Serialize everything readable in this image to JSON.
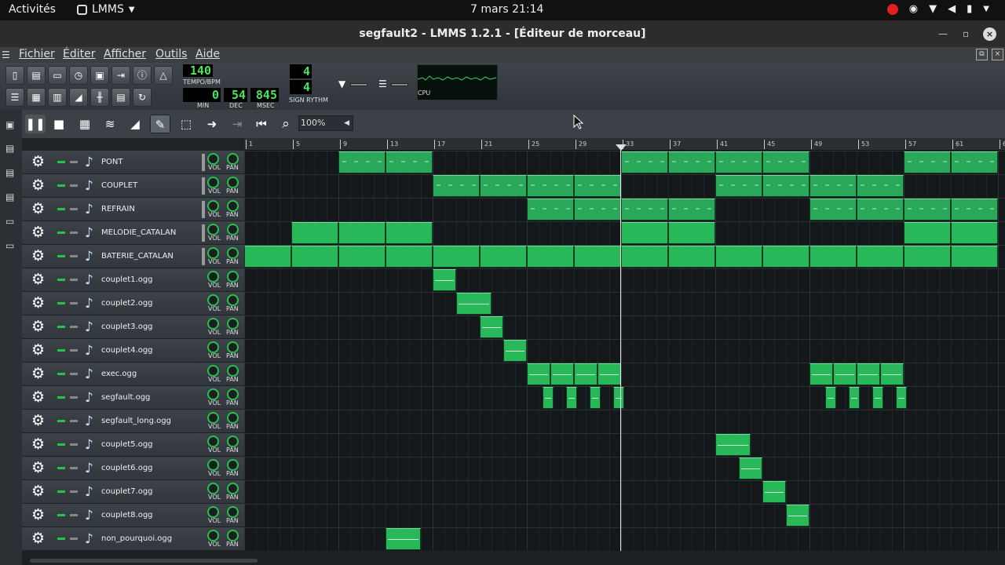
{
  "topbar": {
    "activities": "Activités",
    "app_name": "LMMS",
    "clock": "7 mars  21:14"
  },
  "window": {
    "title": "segfault2 - LMMS 1.2.1 - [Éditeur de morceau]",
    "close": "×"
  },
  "menu": {
    "file": "Fichier",
    "edit": "Éditer",
    "view": "Afficher",
    "tools": "Outils",
    "help": "Aide"
  },
  "toolbar": {
    "tempo_value": "140",
    "tempo_label": "TEMPO/BPM",
    "time_min": "0",
    "time_dec": "54",
    "time_msec": "845",
    "min_label": "MIN",
    "dec_label": "DEC",
    "msec_label": "MSEC",
    "sig_num": "4",
    "sig_den": "4",
    "sig_label": "SIGN RYTHM",
    "cpu_label": "CPU"
  },
  "song_editor": {
    "zoom": "100%"
  },
  "ruler": {
    "labels": [
      "1",
      "5",
      "9",
      "13",
      "17",
      "21",
      "25",
      "29",
      "33",
      "37",
      "41",
      "45",
      "49",
      "53",
      "57",
      "61",
      "6"
    ]
  },
  "track_labels": {
    "vol": "VOL",
    "pan": "PAN"
  },
  "tracks": [
    {
      "name": "PONT",
      "type": "bb"
    },
    {
      "name": "COUPLET",
      "type": "bb"
    },
    {
      "name": "REFRAIN",
      "type": "bb"
    },
    {
      "name": "MELODIE_CATALAN",
      "type": "inst"
    },
    {
      "name": "BATERIE_CATALAN",
      "type": "inst"
    },
    {
      "name": "couplet1.ogg",
      "type": "sample"
    },
    {
      "name": "couplet2.ogg",
      "type": "sample"
    },
    {
      "name": "couplet3.ogg",
      "type": "sample"
    },
    {
      "name": "couplet4.ogg",
      "type": "sample"
    },
    {
      "name": "exec.ogg",
      "type": "sample"
    },
    {
      "name": "segfault.ogg",
      "type": "sample"
    },
    {
      "name": "segfault_long.ogg",
      "type": "sample"
    },
    {
      "name": "couplet5.ogg",
      "type": "sample"
    },
    {
      "name": "couplet6.ogg",
      "type": "sample"
    },
    {
      "name": "couplet7.ogg",
      "type": "sample"
    },
    {
      "name": "couplet8.ogg",
      "type": "sample"
    },
    {
      "name": "non_pourquoi.ogg",
      "type": "sample"
    }
  ],
  "colors": {
    "accent": "#28b85a",
    "background": "#14181a",
    "panel": "#3b4147"
  },
  "icons": {
    "settings": "gear-icon",
    "instrument": "music-note-icon"
  }
}
